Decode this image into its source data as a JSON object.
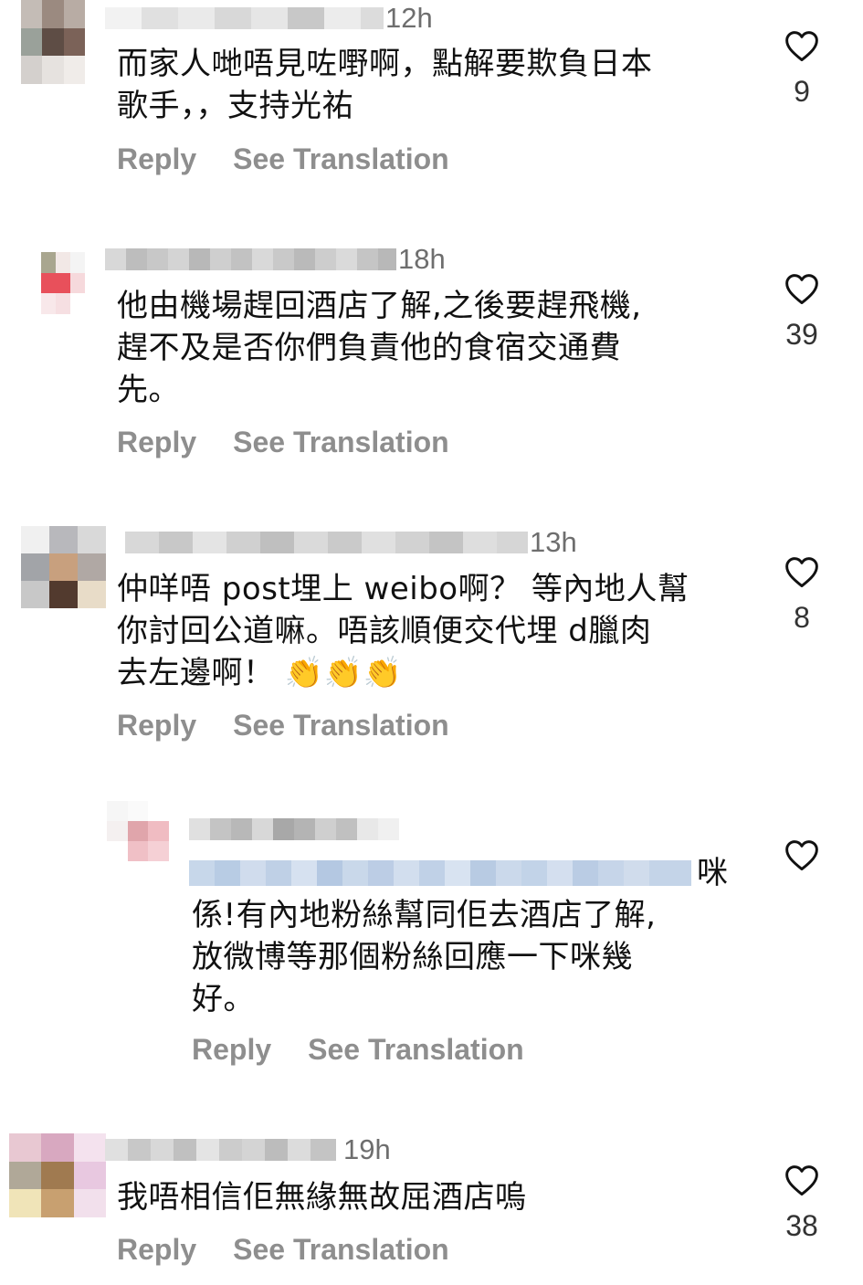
{
  "comments": [
    {
      "time": "12h",
      "lines": [
        "而家人哋唔見咗嘢啊，點解要欺負日本",
        "歌手，，支持光祐"
      ],
      "likes": "9",
      "reply_label": "Reply",
      "translate_label": "See Translation"
    },
    {
      "time": "18h",
      "lines": [
        "他由機場趕回酒店了解,之後要趕飛機,",
        "趕不及是否你們負責他的食宿交通費",
        "先。"
      ],
      "likes": "39",
      "reply_label": "Reply",
      "translate_label": "See Translation"
    },
    {
      "time": "13h",
      "lines": [
        "仲咩唔 post埋上 weibo啊？ 等內地人幫",
        "你討回公道嘛。唔該順便交代埋 d臘肉",
        "去左邊啊！"
      ],
      "emoji": "👏👏👏",
      "likes": "8",
      "reply_label": "Reply",
      "translate_label": "See Translation"
    },
    {
      "mention_suffix": "咪",
      "lines": [
        "係!有內地粉絲幫同佢去酒店了解,",
        "放微博等那個粉絲回應一下咪幾",
        "好。"
      ],
      "likes": "",
      "reply_label": "Reply",
      "translate_label": "See Translation"
    },
    {
      "time": "19h",
      "lines": [
        "我唔相信佢無緣無故屈酒店嗚"
      ],
      "likes": "38",
      "reply_label": "Reply",
      "translate_label": "See Translation"
    }
  ],
  "icons": {
    "like": "heart-outline-icon"
  },
  "colors": {
    "secondary_text": "#8e8e8e",
    "timestamp": "#6e6e6e",
    "mention_blur": "#c9d8ea"
  }
}
